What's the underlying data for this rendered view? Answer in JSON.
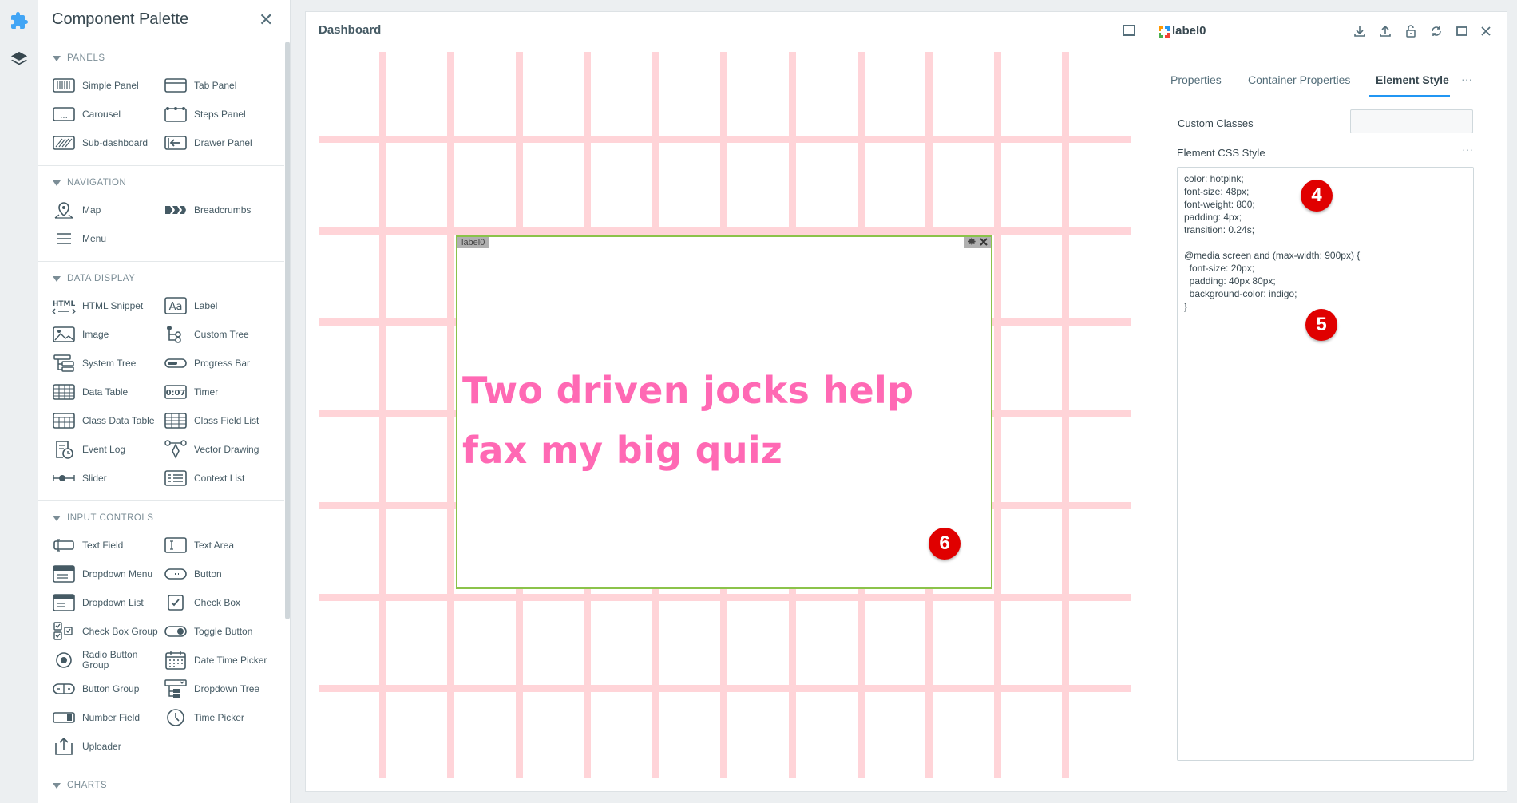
{
  "palette": {
    "title": "Component Palette",
    "sections": {
      "panels": {
        "title": "PANELS",
        "items": [
          "Simple Panel",
          "Tab Panel",
          "Carousel",
          "Steps Panel",
          "Sub-dashboard",
          "Drawer Panel"
        ]
      },
      "navigation": {
        "title": "NAVIGATION",
        "items": [
          "Map",
          "Breadcrumbs",
          "Menu"
        ]
      },
      "data_display": {
        "title": "DATA DISPLAY",
        "items": [
          "HTML Snippet",
          "Label",
          "Image",
          "Custom Tree",
          "System Tree",
          "Progress Bar",
          "Data Table",
          "Timer",
          "Class Data Table",
          "Class Field List",
          "Event Log",
          "Vector Drawing",
          "Slider",
          "Context List"
        ]
      },
      "input_controls": {
        "title": "INPUT CONTROLS",
        "items": [
          "Text Field",
          "Text Area",
          "Dropdown Menu",
          "Button",
          "Dropdown List",
          "Check Box",
          "Check Box Group",
          "Toggle Button",
          "Radio Button Group",
          "Date Time Picker",
          "Button Group",
          "Dropdown Tree",
          "Number Field",
          "Time Picker",
          "Uploader"
        ]
      },
      "charts": {
        "title": "CHARTS"
      }
    },
    "icon_text": {
      "html": "HTML",
      "label": "Aa",
      "timer": "0:07",
      "carousel": "..."
    }
  },
  "dashboard": {
    "title": "Dashboard",
    "label": {
      "tag": "label0",
      "text": "Two driven jocks help fax my big quiz",
      "color": "#ff69b4"
    }
  },
  "inspector": {
    "title": "label0",
    "tabs": [
      "Properties",
      "Container Properties",
      "Element Style"
    ],
    "active_tab": "Element Style",
    "more": "···",
    "custom_classes_label": "Custom Classes",
    "custom_classes_value": "",
    "css_label": "Element CSS Style",
    "css_text": "color: hotpink;\nfont-size: 48px;\nfont-weight: 800;\npadding: 4px;\ntransition: 0.24s;\n\n@media screen and (max-width: 900px) {\n  font-size: 20px;\n  padding: 40px 80px;\n  background-color: indigo;\n}"
  },
  "badges": [
    "4",
    "5",
    "6"
  ],
  "colors": {
    "accent": "#2196f3",
    "grid_line": "#ffcdd2",
    "badge": "#e00000",
    "label_border": "#8bc34a"
  }
}
